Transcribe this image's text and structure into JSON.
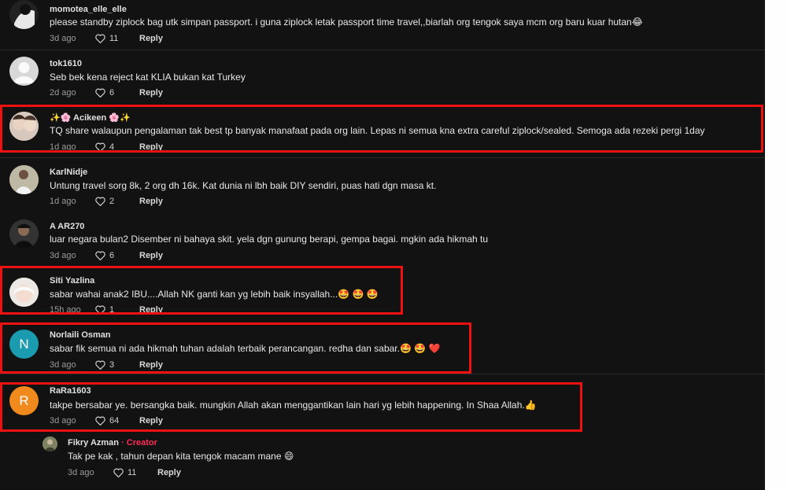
{
  "comments": [
    {
      "user": "momotea_elle_elle",
      "text": "please standby ziplock bag utk simpan passport. i guna ziplock letak passport time travel,,biarlah org tengok saya mcm org baru kuar hutan😂",
      "time": "3d ago",
      "likes": "11",
      "reply": "Reply"
    },
    {
      "user": "tok1610",
      "text": "Seb bek kena reject kat KLIA bukan kat Turkey",
      "time": "2d ago",
      "likes": "6",
      "reply": "Reply"
    },
    {
      "user": "✨🌸 Acikeen 🌸✨",
      "text": "TQ share walaupun pengalaman tak best tp banyak manafaat pada org lain. Lepas ni semua kna extra careful ziplock/sealed. Semoga ada rezeki pergi 1day",
      "time": "1d ago",
      "likes": "4",
      "reply": "Reply"
    },
    {
      "user": "KarlNidje",
      "text": "Untung travel sorg 8k, 2 org dh 16k. Kat dunia ni lbh baik DIY sendiri, puas hati dgn masa kt.",
      "time": "1d ago",
      "likes": "2",
      "reply": "Reply"
    },
    {
      "user": "A AR270",
      "text": "luar negara bulan2 Disember ni bahaya skit. yela dgn gunung berapi, gempa bagai. mgkin ada hikmah tu",
      "time": "3d ago",
      "likes": "6",
      "reply": "Reply"
    },
    {
      "user": "Siti Yazlina",
      "text": "sabar wahai anak2 IBU....Allah NK ganti kan yg lebih baik insyallah...🤩 🤩 🤩",
      "time": "15h ago",
      "likes": "1",
      "reply": "Reply"
    },
    {
      "user": "Norlaili Osman",
      "avatar_letter": "N",
      "text": "sabar fik semua ni ada hikmah tuhan adalah terbaik perancangan. redha dan sabar.🤩 🤩 ❤️",
      "time": "3d ago",
      "likes": "3",
      "reply": "Reply"
    },
    {
      "user": "RaRa1603",
      "avatar_letter": "R",
      "text": "takpe bersabar ye. bersangka baik. mungkin Allah akan menggantikan lain hari yg lebih happening. In Shaa Allah.👍",
      "time": "3d ago",
      "likes": "64",
      "reply": "Reply"
    }
  ],
  "reply_comment": {
    "user": "Fikry Azman",
    "creator_label": "· Creator",
    "text": "Tak pe kak , tahun depan kita tengok macam mane 😄",
    "time": "3d ago",
    "likes": "11",
    "reply": "Reply"
  },
  "colors": {
    "highlight": "#e11111",
    "background": "#121212",
    "creator": "#fe2c55",
    "avatar_n": "#1a9bb0",
    "avatar_r": "#f08a1c"
  }
}
